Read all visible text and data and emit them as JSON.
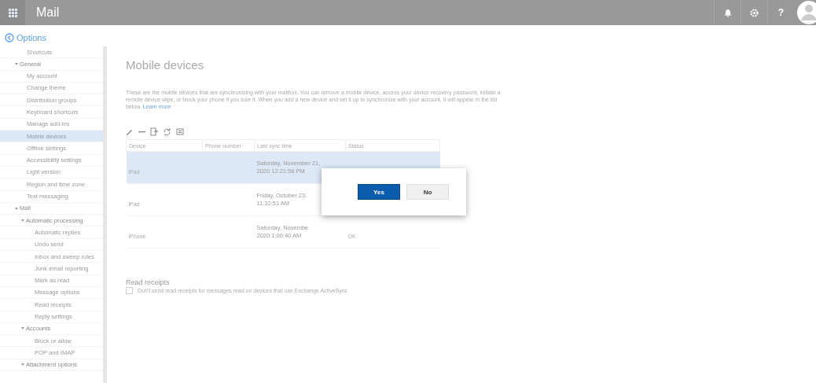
{
  "top_bar": {
    "title": "Mail",
    "help": "?"
  },
  "options": {
    "title": "Options",
    "items": [
      {
        "label": "Shortcuts",
        "selected": false
      },
      {
        "label": "General",
        "expanded": true,
        "selected": false,
        "children": [
          {
            "label": "My account",
            "selected": false
          },
          {
            "label": "Change theme",
            "selected": false
          },
          {
            "label": "Distribution groups",
            "selected": false
          },
          {
            "label": "Keyboard shortcuts",
            "selected": false
          },
          {
            "label": "Manage add-ins",
            "selected": false
          },
          {
            "label": "Mobile devices",
            "selected": true
          },
          {
            "label": "Offline settings",
            "selected": false
          },
          {
            "label": "Accessibility settings",
            "selected": false
          },
          {
            "label": "Light version",
            "selected": false
          },
          {
            "label": "Region and time zone",
            "selected": false
          },
          {
            "label": "Text messaging",
            "selected": false
          }
        ]
      },
      {
        "label": "Mail",
        "expanded": true,
        "selected": false,
        "children": [
          {
            "label": "Automatic processing",
            "expanded": true,
            "selected": false,
            "children": [
              {
                "label": "Automatic replies",
                "selected": false
              },
              {
                "label": "Undo send",
                "selected": false
              },
              {
                "label": "Inbox and sweep rules",
                "selected": false
              },
              {
                "label": "Junk email reporting",
                "selected": false
              },
              {
                "label": "Mark as read",
                "selected": false
              },
              {
                "label": "Message options",
                "selected": false
              },
              {
                "label": "Read receipts",
                "selected": false
              },
              {
                "label": "Reply settings",
                "selected": false
              }
            ]
          },
          {
            "label": "Accounts",
            "expanded": true,
            "selected": false,
            "children": [
              {
                "label": "Block or allow",
                "selected": false
              },
              {
                "label": "POP and IMAP",
                "selected": false
              }
            ]
          },
          {
            "label": "Attachment options",
            "expanded": true,
            "selected": false
          }
        ]
      }
    ]
  },
  "page": {
    "title": "Mobile devices",
    "description": "These are the mobile devices that are synchronizing with your mailbox. You can remove a mobile device, access your device recovery password, initiate a remote device wipe, or block your phone if you lose it. When you add a new device and set it up to synchronize with your account, it will appear in the list below.",
    "learn_more": "Learn more",
    "table": {
      "columns": [
        "Device",
        "Phone number",
        "Last sync time",
        "Status"
      ],
      "rows": [
        {
          "device": "iPad",
          "phone": "",
          "sync": [
            "Saturday, November 21,",
            "2020 12:21:58 PM"
          ],
          "status": "",
          "selected": true
        },
        {
          "device": "iPad",
          "phone": "",
          "sync": [
            "Friday, October 23,",
            "11:32:51 AM"
          ],
          "status": "",
          "selected": false
        },
        {
          "device": "iPhone",
          "phone": "",
          "sync": [
            "Saturday, Novembe",
            "2020 1:00:40 AM"
          ],
          "status": "OK",
          "selected": false
        }
      ]
    },
    "read_receipts": {
      "title": "Read receipts",
      "label": "Don't send read receipts for messages read on devices that use Exchange ActiveSync",
      "checked": false
    }
  },
  "dialog": {
    "buttons": [
      {
        "label": "Yes",
        "primary": true
      },
      {
        "label": "No",
        "primary": false
      }
    ]
  }
}
